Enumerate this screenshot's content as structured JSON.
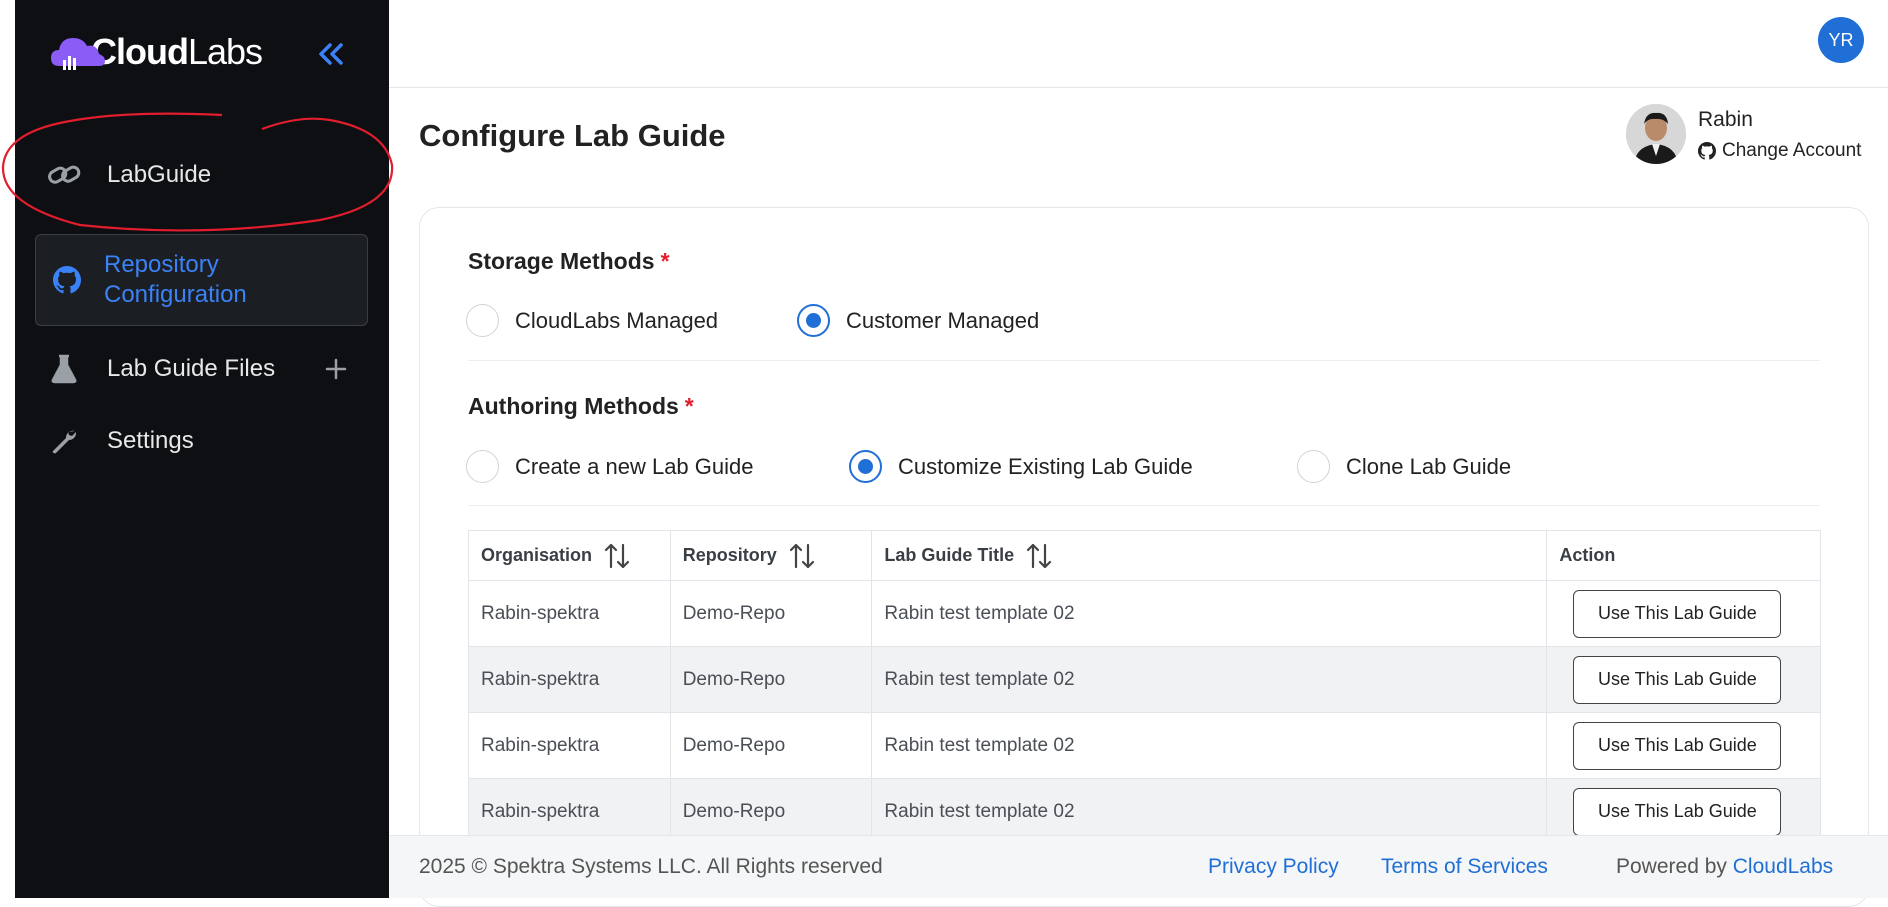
{
  "brand": {
    "name_bold": "Cloud",
    "name_thin": "Labs",
    "accent": "#7c3aed"
  },
  "sidebar": {
    "items": [
      {
        "label": "LabGuide",
        "icon": "link-icon"
      },
      {
        "label": "Repository Configuration",
        "line1": "Repository",
        "line2": "Configuration",
        "icon": "github-icon",
        "active": true
      },
      {
        "label": "Lab Guide Files",
        "icon": "flask-icon"
      },
      {
        "label": "Settings",
        "icon": "wrench-icon"
      }
    ]
  },
  "topbar": {
    "avatar_initials": "YR"
  },
  "page": {
    "title": "Configure Lab Guide"
  },
  "account": {
    "name": "Rabin",
    "change_label": "Change Account"
  },
  "storage": {
    "title": "Storage Methods",
    "required_mark": "*",
    "options": [
      {
        "label": "CloudLabs Managed",
        "selected": false
      },
      {
        "label": "Customer Managed",
        "selected": true
      }
    ]
  },
  "authoring": {
    "title": "Authoring Methods",
    "required_mark": "*",
    "options": [
      {
        "label": "Create a new Lab Guide",
        "selected": false
      },
      {
        "label": "Customize Existing Lab Guide",
        "selected": true
      },
      {
        "label": "Clone Lab Guide",
        "selected": false
      }
    ]
  },
  "table": {
    "headers": [
      "Organisation",
      "Repository",
      "Lab Guide Title",
      "Action"
    ],
    "rows": [
      {
        "org": "Rabin-spektra",
        "repo": "Demo-Repo",
        "title": "Rabin test template 02",
        "action": "Use This Lab Guide"
      },
      {
        "org": "Rabin-spektra",
        "repo": "Demo-Repo",
        "title": "Rabin test template 02",
        "action": "Use This Lab Guide"
      },
      {
        "org": "Rabin-spektra",
        "repo": "Demo-Repo",
        "title": "Rabin test template 02",
        "action": "Use This Lab Guide"
      },
      {
        "org": "Rabin-spektra",
        "repo": "Demo-Repo",
        "title": "Rabin test template 02",
        "action": "Use This Lab Guide"
      }
    ]
  },
  "footer": {
    "copyright": "2025 © Spektra Systems LLC. All Rights reserved",
    "privacy": "Privacy Policy",
    "terms": "Terms of Services",
    "powered_prefix": "Powered by",
    "powered_brand": "CloudLabs"
  },
  "colors": {
    "primary": "#1f6fd6",
    "sidebar_bg": "#0d0f12",
    "required": "#e11d2e",
    "annotation": "#e11d2e"
  }
}
